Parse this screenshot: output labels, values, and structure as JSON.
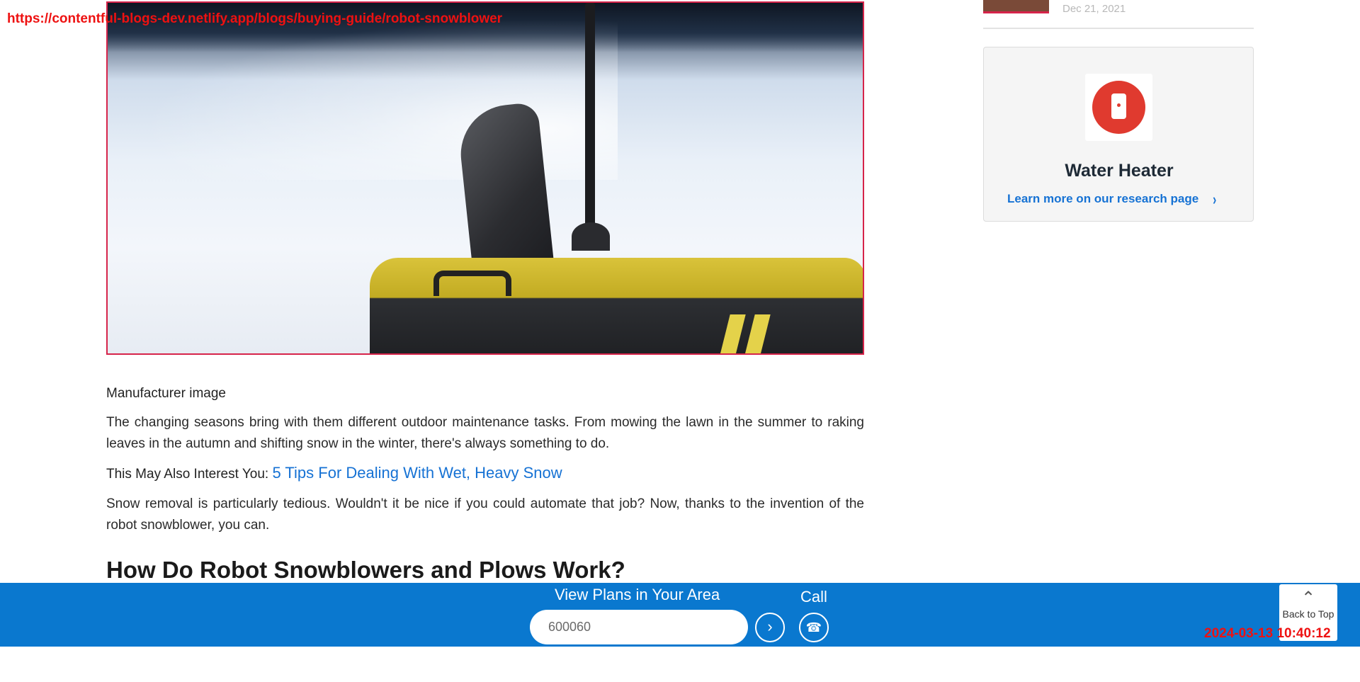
{
  "overlay": {
    "url": "https://contentful-blogs-dev.netlify.app/blogs/buying-guide/robot-snowblower",
    "timestamp": "2024-03-13 10:40:12"
  },
  "article": {
    "caption": "Manufacturer image",
    "paragraph1": "The changing seasons bring with them different outdoor maintenance tasks. From mowing the lawn in the summer to raking leaves in the autumn and shifting snow in the winter, there's always something to do.",
    "interest_label": "This May Also Interest You:",
    "interest_link": "5 Tips For Dealing With Wet, Heavy Snow",
    "paragraph2": "Snow removal is particularly tedious. Wouldn't it be nice if you could automate that job? Now, thanks to the invention of the robot snowblower, you can.",
    "heading": "How Do Robot Snowblowers and Plows Work?"
  },
  "sidebar": {
    "date": "Dec 21, 2021",
    "card": {
      "icon": "water-heater-icon",
      "title": "Water Heater",
      "link": "Learn more on our research page",
      "chevron": "›"
    }
  },
  "bottom_bar": {
    "plans_label": "View Plans in Your Area",
    "zip_value": "600060",
    "go_icon": "›",
    "call_label": "Call",
    "phone_icon": "☎",
    "back_to_top_arrow": "⌃",
    "back_to_top_label": "Back to Top"
  },
  "colors": {
    "accent_blue": "#0a78cf",
    "link_blue": "#1672d4",
    "brand_red": "#e03a2f",
    "hero_border": "#d6244a"
  }
}
